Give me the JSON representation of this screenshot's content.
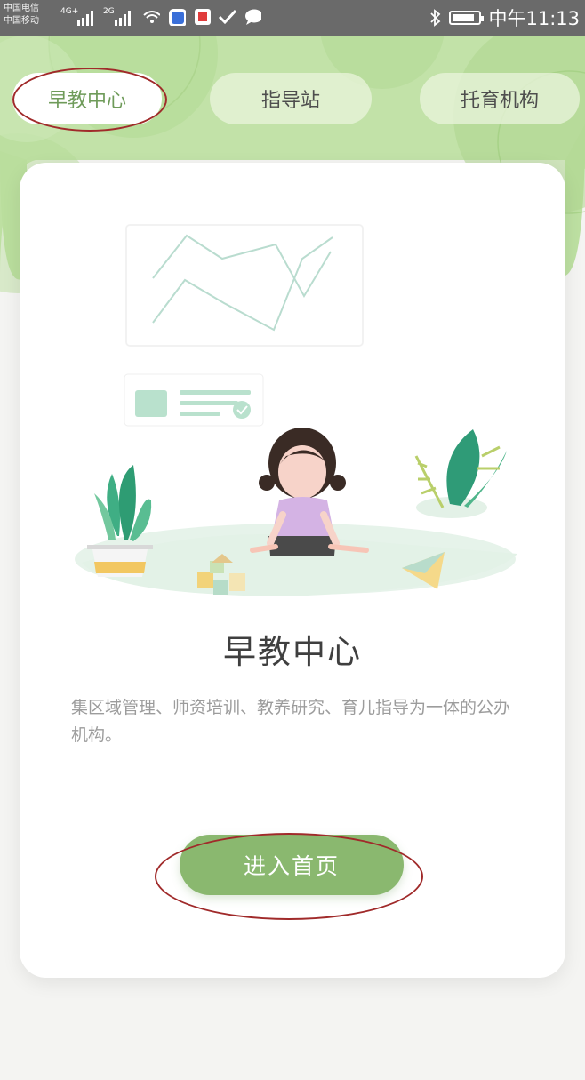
{
  "status_bar": {
    "carrier_1": "中国电信",
    "carrier_2": "中国移动",
    "net_1": "4G+",
    "net_2": "2G",
    "time": "中午11:13",
    "battery_level": 0.85
  },
  "tabs": [
    {
      "label": "早教中心",
      "active": true
    },
    {
      "label": "指导站",
      "active": false
    },
    {
      "label": "托育机构",
      "active": false
    }
  ],
  "card": {
    "title": "早教中心",
    "description": "集区域管理、师资培训、教养研究、育儿指导为一体的公办机构。",
    "button_label": "进入首页"
  },
  "colors": {
    "accent_green": "#8ab86f",
    "header_green": "#bfe0a6",
    "annotation_red": "#a02a2a"
  }
}
